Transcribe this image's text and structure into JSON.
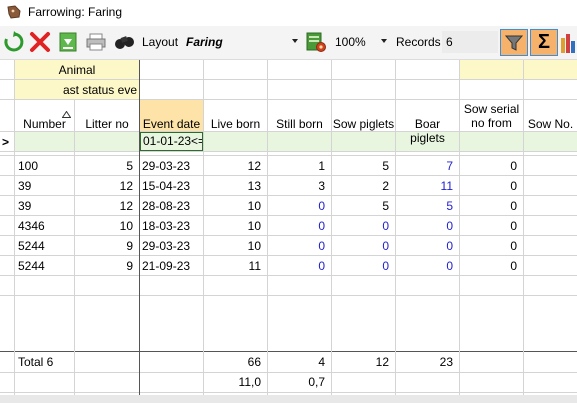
{
  "window": {
    "title": "Farrowing: Faring"
  },
  "toolbar": {
    "layout_label": "Layout",
    "layout_value": "Faring",
    "zoom_value": "100%",
    "records_label": "Records",
    "records_value": "6",
    "sigma_label": "Σ"
  },
  "grid": {
    "group_header": "Animal",
    "sub_header": "ast status eve",
    "columns": [
      "Number",
      "Litter no",
      "Event date",
      "Live born",
      "Still born",
      "Sow piglets",
      "Boar piglets",
      "Sow serial no from",
      "Sow No."
    ],
    "filter_value": "01-01-23<=",
    "row_indicator": ">",
    "rows": [
      {
        "number": "100",
        "litter_no": "5",
        "event_date": "29-03-23",
        "live_born": "12",
        "still_born": "1",
        "sow_piglets": "5",
        "boar_piglets": "7",
        "sow_serial": "0"
      },
      {
        "number": "39",
        "litter_no": "12",
        "event_date": "15-04-23",
        "live_born": "13",
        "still_born": "3",
        "sow_piglets": "2",
        "boar_piglets": "11",
        "sow_serial": "0"
      },
      {
        "number": "39",
        "litter_no": "12",
        "event_date": "28-08-23",
        "live_born": "10",
        "still_born": "0",
        "sow_piglets": "5",
        "boar_piglets": "5",
        "sow_serial": "0"
      },
      {
        "number": "4346",
        "litter_no": "10",
        "event_date": "18-03-23",
        "live_born": "10",
        "still_born": "0",
        "sow_piglets": "0",
        "boar_piglets": "0",
        "sow_serial": "0"
      },
      {
        "number": "5244",
        "litter_no": "9",
        "event_date": "29-03-23",
        "live_born": "10",
        "still_born": "0",
        "sow_piglets": "0",
        "boar_piglets": "0",
        "sow_serial": "0"
      },
      {
        "number": "5244",
        "litter_no": "9",
        "event_date": "21-09-23",
        "live_born": "11",
        "still_born": "0",
        "sow_piglets": "0",
        "boar_piglets": "0",
        "sow_serial": "0"
      }
    ],
    "totals": {
      "label": "Total 6",
      "live_born": "66",
      "still_born": "4",
      "sow_piglets": "12",
      "boar_piglets": "23",
      "live_born_avg": "11,0",
      "still_born_avg": "0,7"
    },
    "colors": {
      "group_header": "#fdf8c8",
      "active_header": "#fde3a7",
      "filter_row": "#e8f6e0",
      "link_blue": "#1f1fd0"
    }
  }
}
